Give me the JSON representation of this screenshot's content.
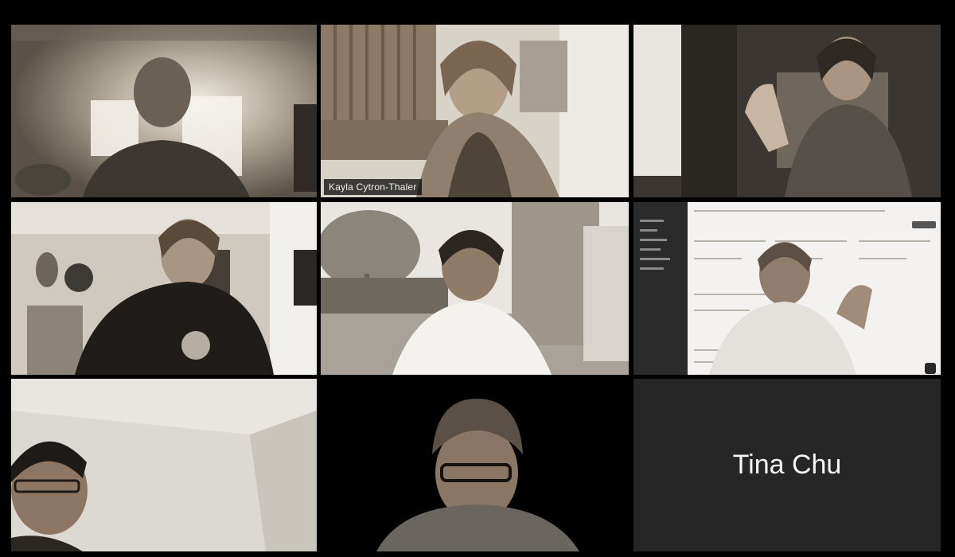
{
  "meeting": {
    "participants": [
      {
        "id": "p1",
        "name": "",
        "video": true
      },
      {
        "id": "p2",
        "name": "Kayla Cytron-Thaler",
        "video": true,
        "active_speaker": true
      },
      {
        "id": "p3",
        "name": "",
        "video": true
      },
      {
        "id": "p4",
        "name": "",
        "video": true
      },
      {
        "id": "p5",
        "name": "",
        "video": true
      },
      {
        "id": "p6",
        "name": "",
        "video": true,
        "screen_share_background": true
      },
      {
        "id": "p7",
        "name": "",
        "video": true
      },
      {
        "id": "p8",
        "name": "",
        "video": true
      },
      {
        "id": "p9",
        "name": "Tina Chu",
        "video": false
      }
    ]
  },
  "colors": {
    "background": "#000000",
    "active_border": "#d9d6cf",
    "name_tile_bg": "#262626",
    "label_bg": "#000000"
  }
}
